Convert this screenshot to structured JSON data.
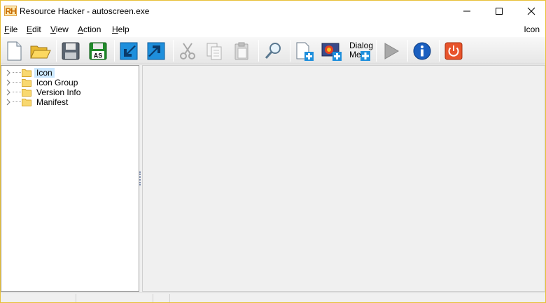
{
  "window": {
    "title": "Resource Hacker - autoscreen.exe",
    "logo_text": "RH"
  },
  "menu": {
    "file": "File",
    "edit": "Edit",
    "view": "View",
    "action": "Action",
    "help": "Help",
    "right_label": "Icon"
  },
  "toolbar": {
    "dialog_line1": "Dialog",
    "dialog_line2": "Menu"
  },
  "tree": {
    "items": [
      {
        "label": "Icon",
        "selected": true
      },
      {
        "label": "Icon Group",
        "selected": false
      },
      {
        "label": "Version Info",
        "selected": false
      },
      {
        "label": "Manifest",
        "selected": false
      }
    ]
  },
  "colors": {
    "selection": "#cce8ff",
    "window_border": "#e8c038",
    "toolbar_blue_arrow": "#1e8fdc",
    "run_gray": "#909090",
    "info_blue": "#1a5fc0",
    "exit_orange": "#e8542c"
  }
}
